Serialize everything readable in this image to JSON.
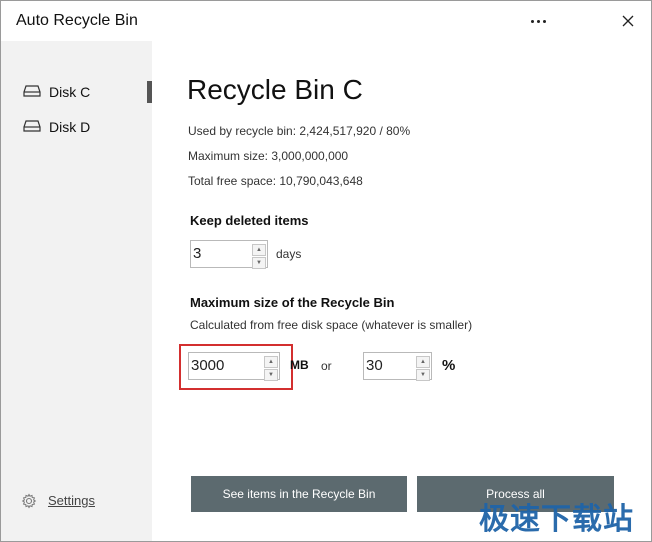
{
  "window": {
    "title": "Auto Recycle Bin"
  },
  "titlebar": {
    "more_icon": "more-horizontal-icon",
    "close_icon": "close-icon"
  },
  "sidebar": {
    "items": [
      {
        "label": "Disk C",
        "icon": "drive-icon",
        "active": true
      },
      {
        "label": "Disk D",
        "icon": "drive-icon",
        "active": false
      }
    ],
    "settings": {
      "label": "Settings",
      "icon": "gear-icon"
    }
  },
  "main": {
    "title": "Recycle Bin C",
    "used": "Used by recycle bin: 2,424,517,920 / 80%",
    "max_size": "Maximum size: 3,000,000,000",
    "free_space": "Total free space: 10,790,043,648",
    "keep": {
      "heading": "Keep deleted items",
      "value": "3",
      "unit": "days"
    },
    "maxsize": {
      "heading": "Maximum size of the Recycle Bin",
      "subtext": "Calculated from free disk space (whatever is smaller)",
      "mb_value": "3000",
      "mb_unit": "MB",
      "or_label": "or",
      "percent_value": "30",
      "percent_unit": "%"
    },
    "buttons": {
      "see_items": "See items in the Recycle Bin",
      "process_all": "Process all"
    }
  },
  "watermark": "极速下载站",
  "colors": {
    "button_bg": "#5c6a6f",
    "highlight_border": "#d32f2f",
    "watermark": "#1f64a8",
    "sidebar_bg": "#f2f2f2"
  }
}
